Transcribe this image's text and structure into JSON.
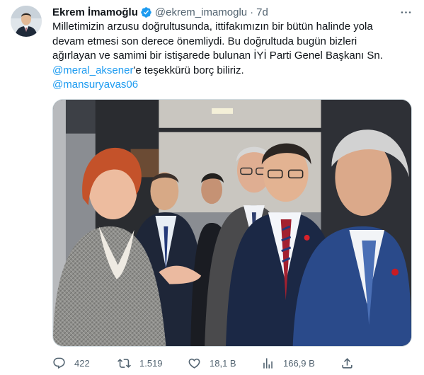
{
  "author": {
    "name": "Ekrem İmamoğlu",
    "handle": "@ekrem_imamoglu",
    "separator": "·",
    "time": "7d"
  },
  "tweet": {
    "line1": "Milletimizin arzusu doğrultusunda, ittifakımızın bir bütün halinde yola",
    "line2": "devam etmesi son derece önemliydi. Bu doğrultuda bugün bizleri",
    "line3": "ağırlayan ve samimi bir istişarede bulunan İYİ Parti Genel Başkanı Sn.",
    "mention1": "@meral_aksener",
    "line4_suffix": "'e teşekkürü borç biliriz.",
    "mention2": "@mansuryavas06"
  },
  "stats": {
    "replies": "422",
    "retweets": "1.519",
    "likes": "18,1 B",
    "views": "166,9 B"
  },
  "colors": {
    "link": "#1d9bf0",
    "verified": "#1d9bf0",
    "secondary_text": "#536471"
  },
  "icons": [
    "verified-badge-icon",
    "more-options-icon",
    "reply-icon",
    "retweet-icon",
    "like-icon",
    "views-icon",
    "share-icon"
  ]
}
